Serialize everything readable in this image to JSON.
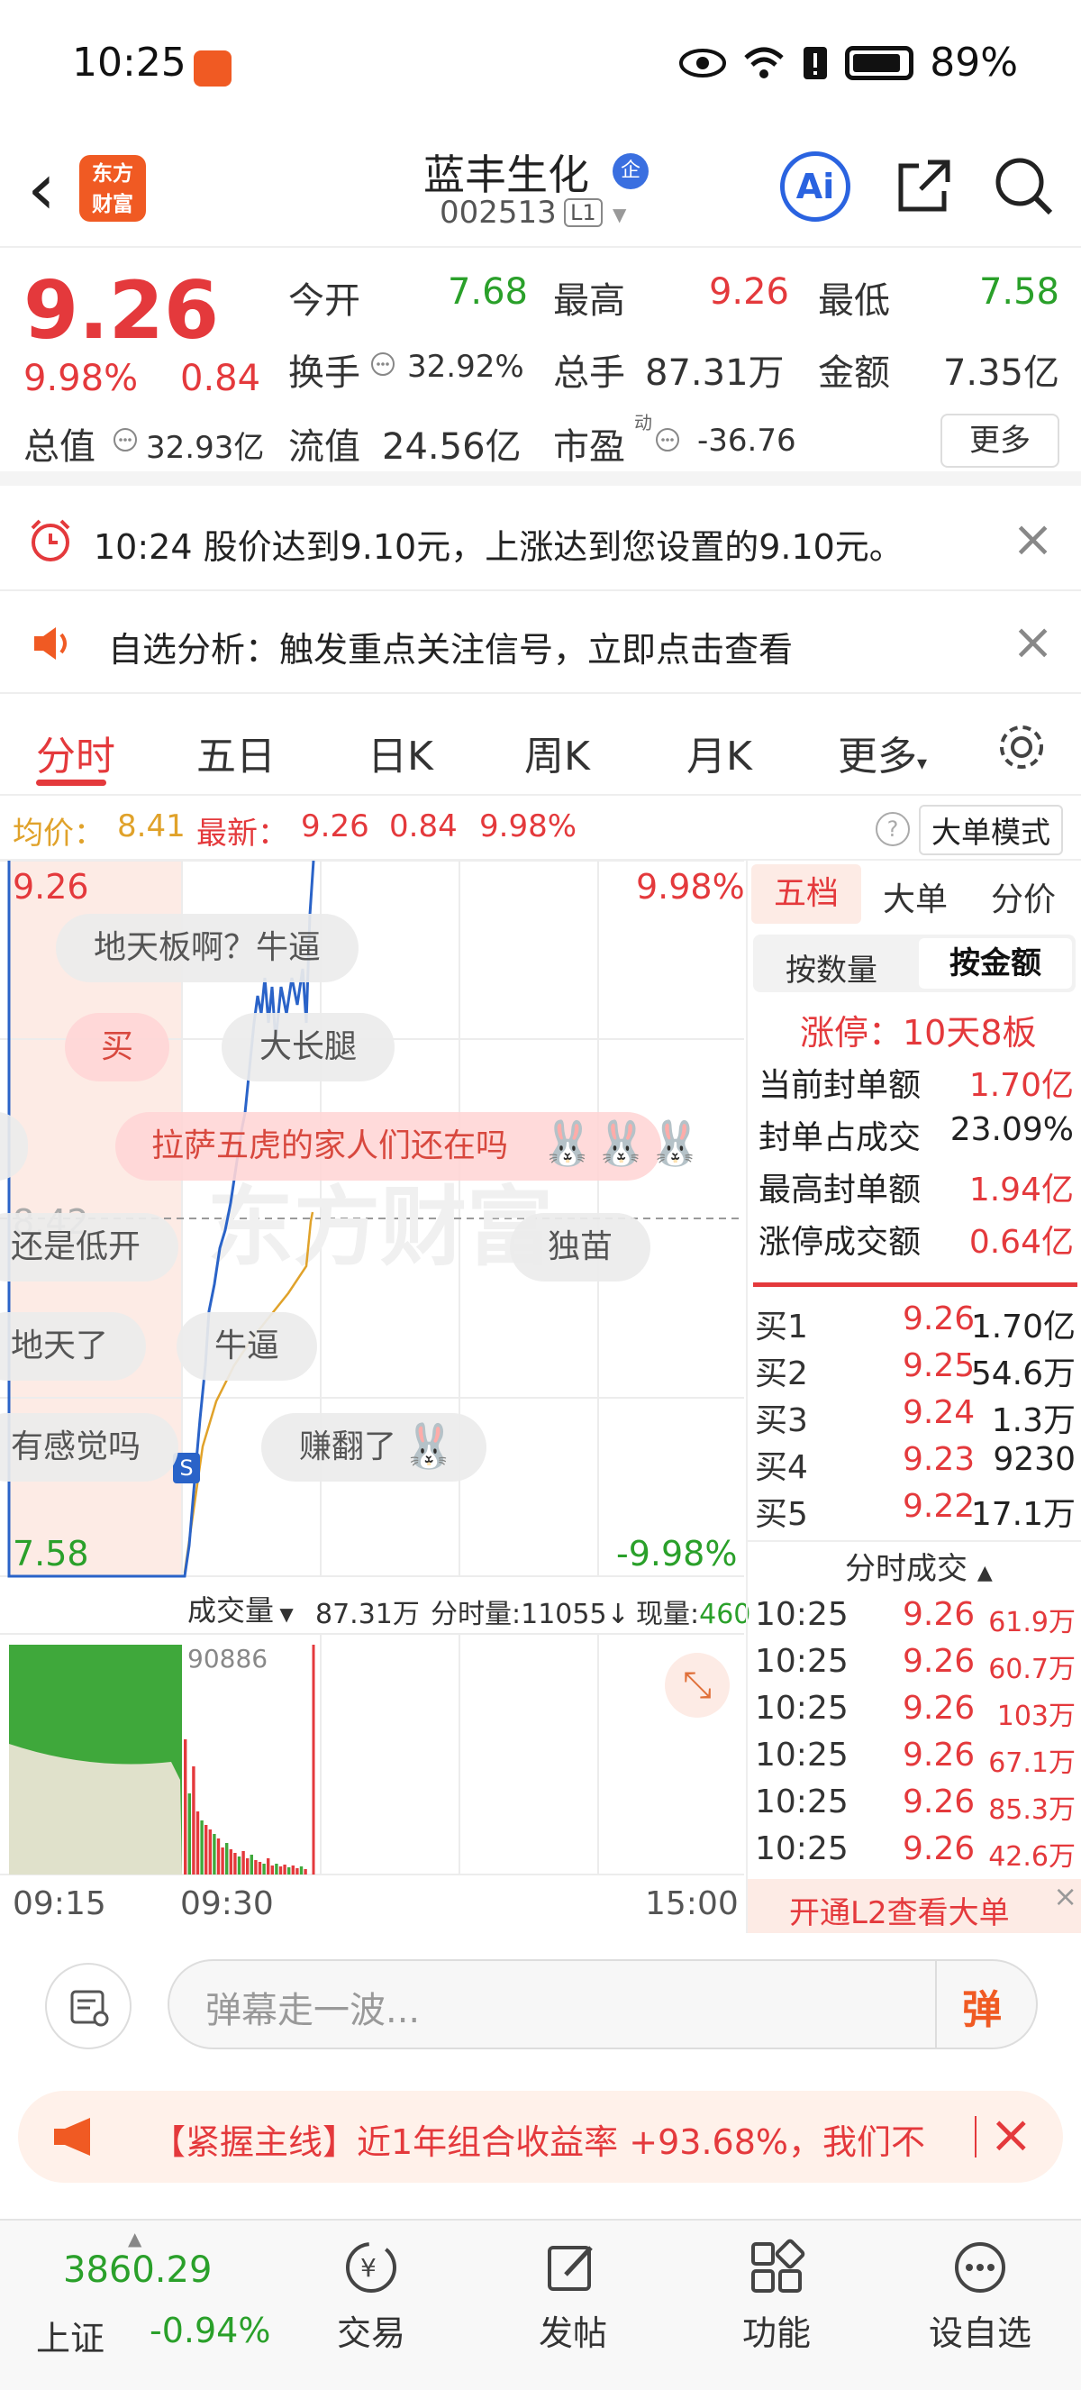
{
  "status_bar": {
    "time": "10:25",
    "battery": "89%"
  },
  "header": {
    "stock_name": "蓝丰生化",
    "badge": "企",
    "stock_code": "002513",
    "level": "L1",
    "logo_line1": "东方",
    "logo_line2": "财富",
    "ai_label": "Ai"
  },
  "quote": {
    "last_price": "9.26",
    "change_pct": "9.98%",
    "change_amt": "0.84",
    "open_label": "今开",
    "open": "7.68",
    "high_label": "最高",
    "high": "9.26",
    "low_label": "最低",
    "low": "7.58",
    "turnover_rate_label": "换手",
    "turnover_rate": "32.92%",
    "volume_label": "总手",
    "volume": "87.31万",
    "amount_label": "金额",
    "amount": "7.35亿",
    "total_mv_label": "总值",
    "total_mv": "32.93亿",
    "float_mv_label": "流值",
    "float_mv": "24.56亿",
    "pe_label": "市盈",
    "pe_sup": "动",
    "pe": "-36.76",
    "more": "更多"
  },
  "notices": [
    {
      "text": "10:24 股价达到9.10元，上涨达到您设置的9.10元。"
    },
    {
      "text": "自选分析：触发重点关注信号，立即点击查看"
    }
  ],
  "tabs": [
    "分时",
    "五日",
    "日K",
    "周K",
    "月K",
    "更多"
  ],
  "info_strip": {
    "avg_label": "均价：",
    "avg": "8.41",
    "latest_label": "最新：",
    "latest": "9.26",
    "latest_chg": "0.84",
    "latest_pct": "9.98%",
    "mode_button": "大单模式"
  },
  "chart_labels": {
    "price_top": "9.26",
    "price_mid": "8.42",
    "price_bottom": "7.58",
    "pct_top": "9.98%",
    "pct_bottom": "-9.98%",
    "vol_dropdown": "成交量",
    "vol_total": "87.31万",
    "vol_minute_label": "分时量:",
    "vol_minute": "11055",
    "vol_now_label": "现量:",
    "vol_now": "460",
    "vol_max": "90886",
    "time_start": "09:15",
    "time_open": "09:30",
    "time_end": "15:00",
    "s_marker": "S",
    "watermark": "东方财富"
  },
  "danmaku": [
    "地天板啊？牛逼",
    "买",
    "大长腿",
    "拉萨五虎的家人们还在吗",
    "还是低开",
    "独苗",
    "地天了",
    "牛逼",
    "有感觉吗",
    "赚翻了"
  ],
  "right_panel": {
    "tabs": [
      "五档",
      "大单",
      "分价"
    ],
    "subtabs": [
      "按数量",
      "按金额"
    ],
    "limit_up": "涨停：10天8板",
    "stats": [
      {
        "label": "当前封单额",
        "value": "1.70亿"
      },
      {
        "label": "封单占成交",
        "value": "23.09%"
      },
      {
        "label": "最高封单额",
        "value": "1.94亿"
      },
      {
        "label": "涨停成交额",
        "value": "0.64亿"
      }
    ],
    "bids": [
      {
        "label": "买1",
        "price": "9.26",
        "amount": "1.70亿"
      },
      {
        "label": "买2",
        "price": "9.25",
        "amount": "54.6万"
      },
      {
        "label": "买3",
        "price": "9.24",
        "amount": "1.3万"
      },
      {
        "label": "买4",
        "price": "9.23",
        "amount": "9230"
      },
      {
        "label": "买5",
        "price": "9.22",
        "amount": "17.1万"
      }
    ],
    "trades_title": "分时成交",
    "trades": [
      {
        "time": "10:25",
        "price": "9.26",
        "amount": "61.9万"
      },
      {
        "time": "10:25",
        "price": "9.26",
        "amount": "60.7万"
      },
      {
        "time": "10:25",
        "price": "9.26",
        "amount": "103万"
      },
      {
        "time": "10:25",
        "price": "9.26",
        "amount": "67.1万"
      },
      {
        "time": "10:25",
        "price": "9.26",
        "amount": "85.3万"
      },
      {
        "time": "10:25",
        "price": "9.26",
        "amount": "42.6万"
      }
    ],
    "l2_banner": "开通L2查看大单"
  },
  "input": {
    "placeholder": "弹幕走一波...",
    "send": "弹"
  },
  "promo": {
    "text": "【紧握主线】近1年组合收益率 +93.68%，我们不"
  },
  "bottom_nav": {
    "index_value": "3860.29",
    "index_name": "上证",
    "index_change": "-0.94%",
    "items": [
      "交易",
      "发帖",
      "功能",
      "设自选"
    ]
  },
  "colors": {
    "up": "#e4393c",
    "down": "#2aa02a",
    "avg_line": "#e0a22a",
    "price_line": "#2a63c8"
  }
}
